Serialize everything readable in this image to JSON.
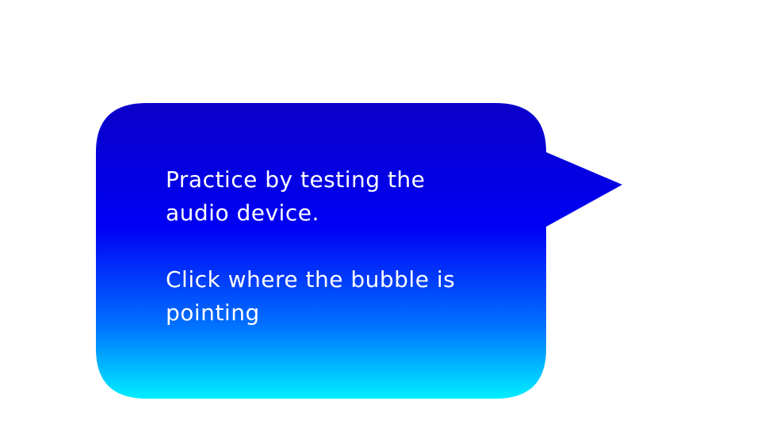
{
  "bubble": {
    "line1": "Practice by testing the",
    "line2": "audio device.",
    "line3": "Click where the bubble is",
    "line4": "pointing"
  },
  "colors": {
    "background": "#ffffff",
    "gradient_top": "#0a00c8",
    "gradient_mid": "#0000f5",
    "gradient_bottom": "#00eeff",
    "text": "#ffffff"
  }
}
